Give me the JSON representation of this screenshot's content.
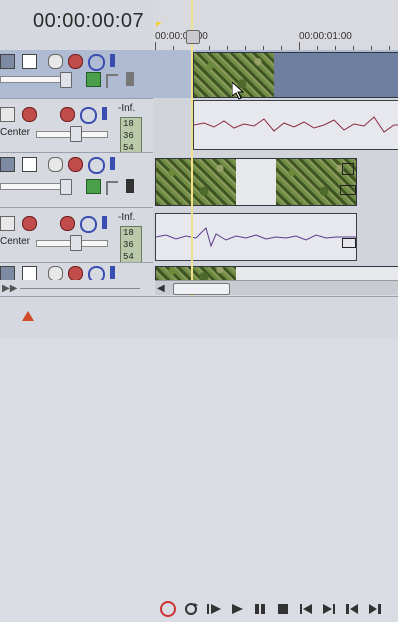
{
  "app": {
    "timecode": "00:00:00:07"
  },
  "ruler": {
    "label_start": "00:00:00:00",
    "label_end": "00:00:01:00"
  },
  "tracks": [
    {
      "type": "video",
      "selected": true
    },
    {
      "type": "audio",
      "pan_label": "Center",
      "level_label": "-Inf.",
      "meter": [
        "18",
        "36",
        "54"
      ]
    },
    {
      "type": "video",
      "selected": false
    },
    {
      "type": "audio",
      "pan_label": "Center",
      "level_label": "-Inf.",
      "meter": [
        "18",
        "36",
        "54"
      ]
    }
  ],
  "colors": {
    "audio_wave_1": "#8c2a3c",
    "audio_wave_2": "#5c3a8c",
    "playhead": "#f2e38a",
    "selected_lane": "#aebbd2"
  }
}
